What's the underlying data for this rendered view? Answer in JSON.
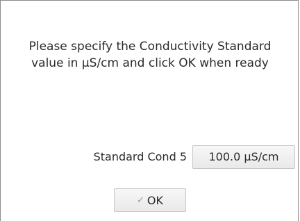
{
  "prompt": {
    "line1": "Please specify the Conductivity Standard",
    "line2": "value in µS/cm and click OK when ready"
  },
  "standard": {
    "label": "Standard Cond 5",
    "value": "100.0 µS/cm"
  },
  "ok_button": {
    "icon": "check-icon",
    "label": "OK"
  }
}
